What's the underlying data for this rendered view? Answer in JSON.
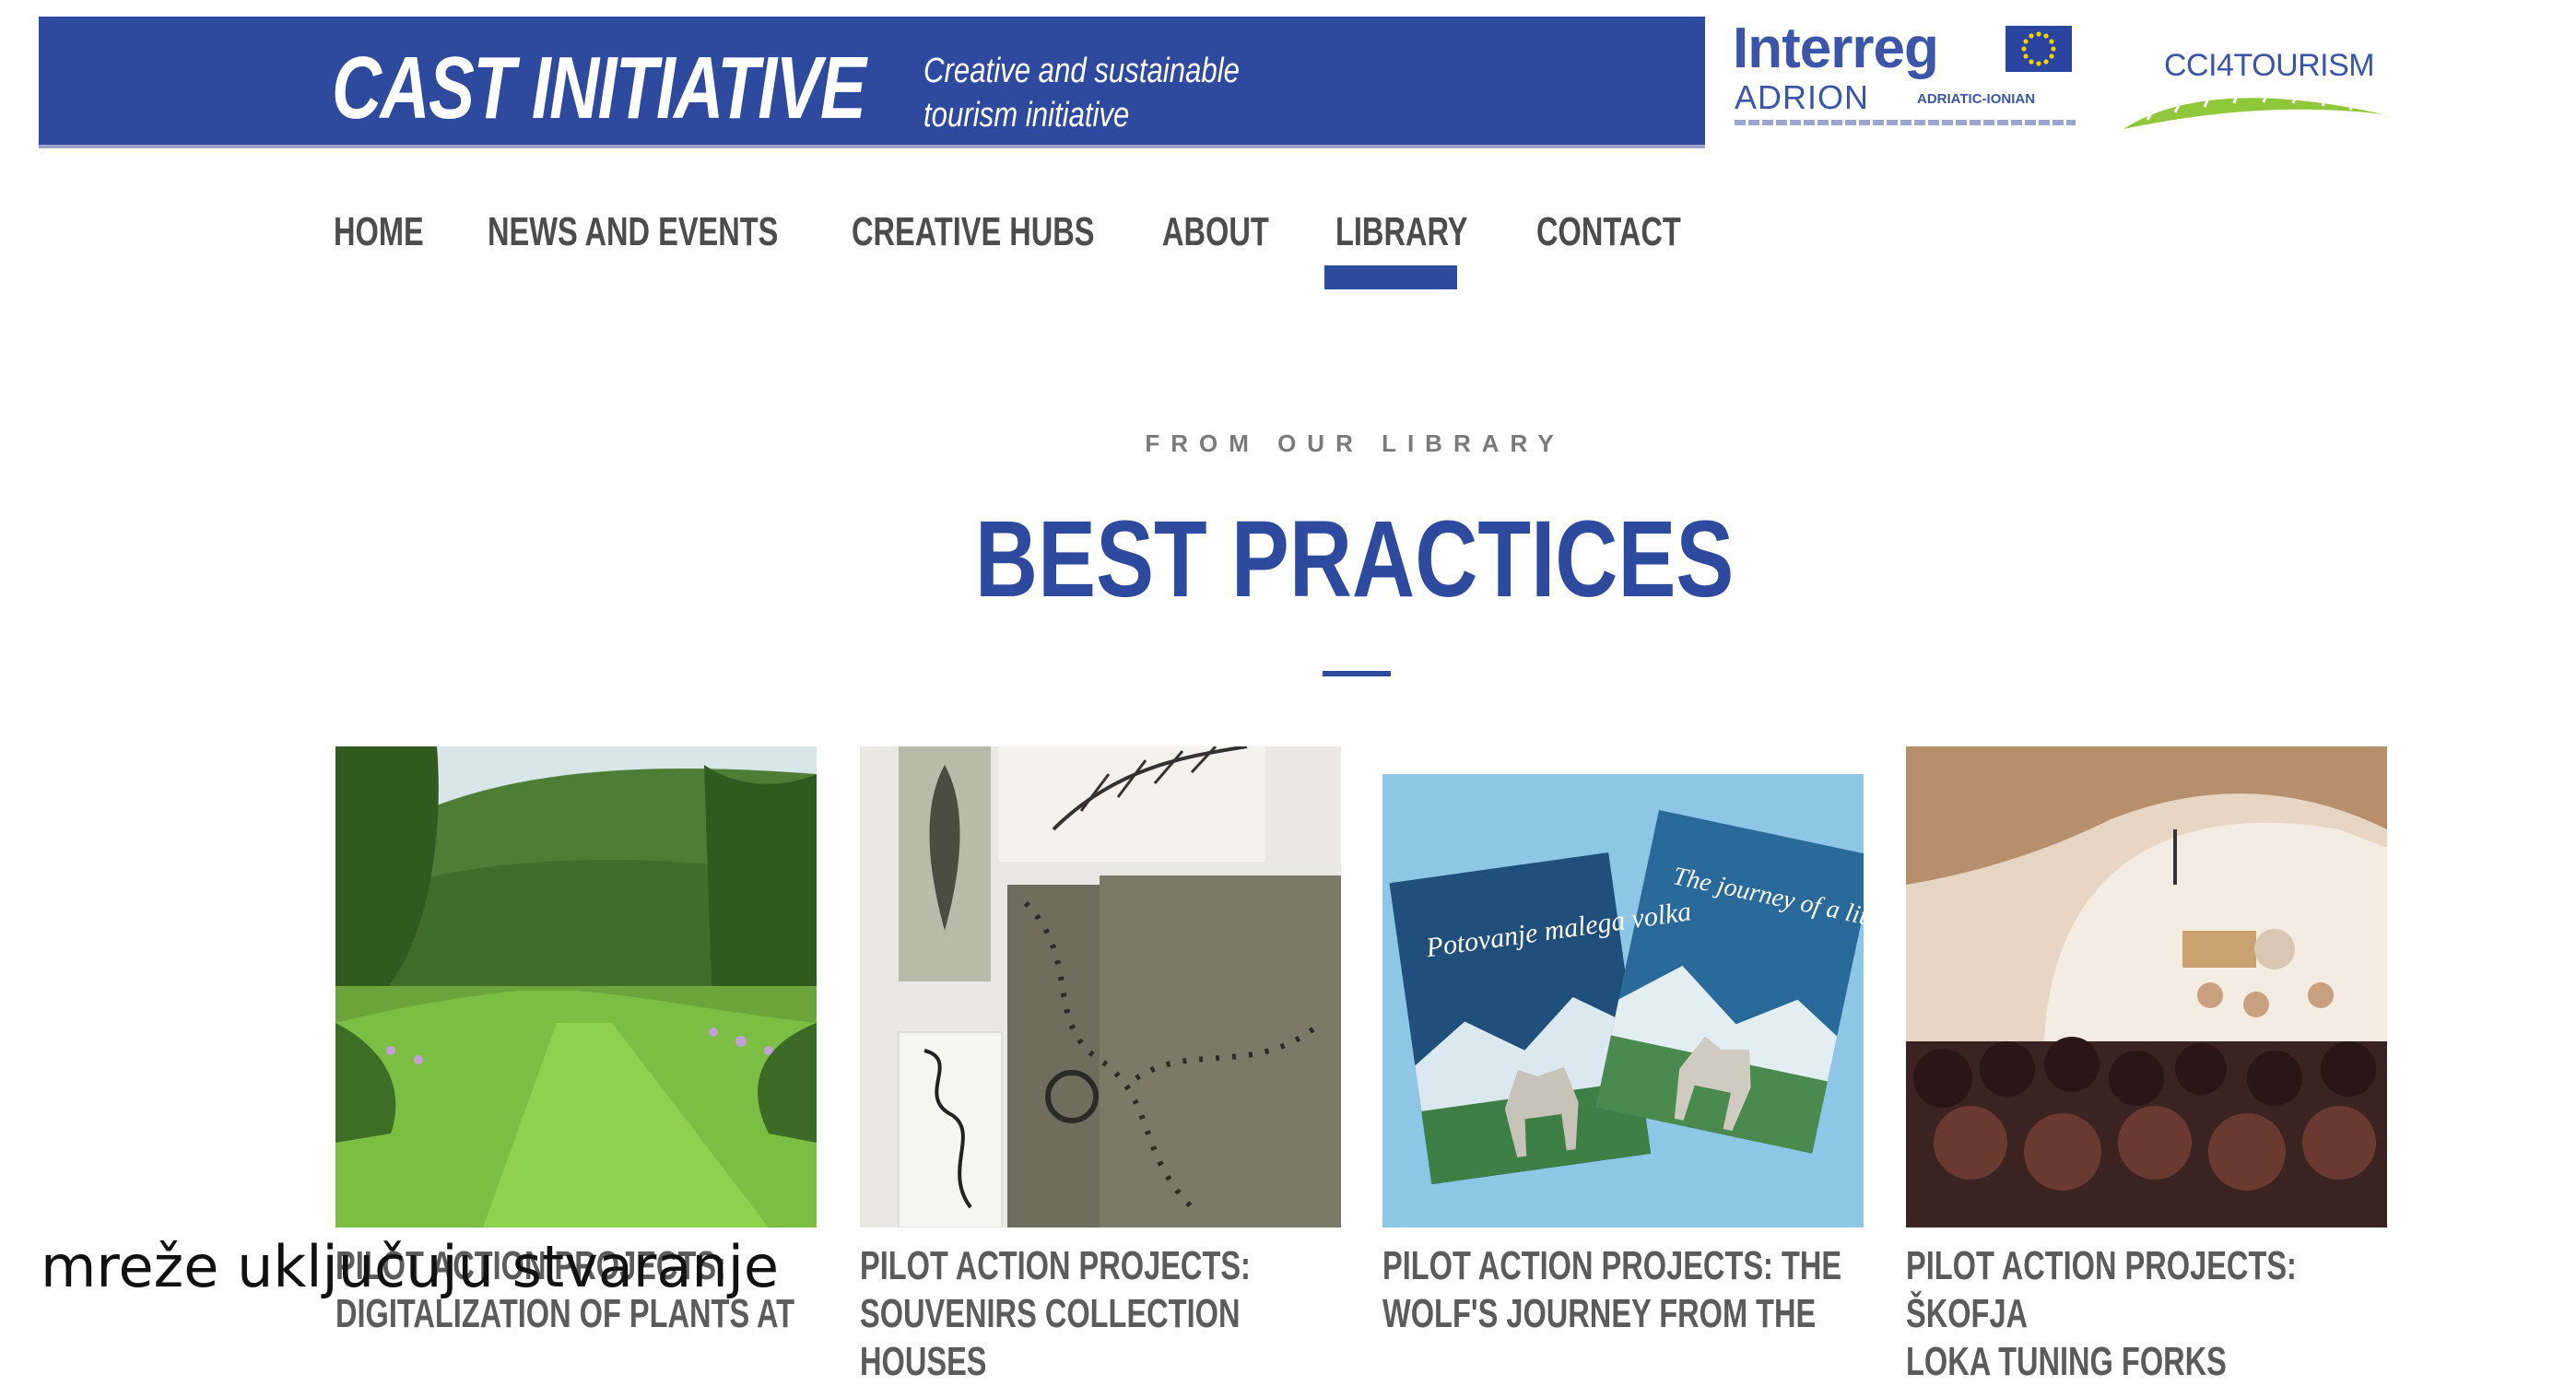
{
  "header": {
    "brand": "CAST INITIATIVE",
    "tagline_line1": "Creative and sustainable",
    "tagline_line2": "tourism initiative",
    "partner_logo_1": {
      "name": "Interreg",
      "subtitle": "ADRION",
      "sub2": "ADRIATIC-IONIAN"
    },
    "partner_logo_2": {
      "name": "CCI4TOURISM"
    }
  },
  "nav": {
    "items": [
      "HOME",
      "NEWS AND EVENTS",
      "CREATIVE HUBS",
      "ABOUT",
      "LIBRARY",
      "CONTACT"
    ],
    "active": "LIBRARY"
  },
  "section": {
    "eyebrow": "FROM OUR LIBRARY",
    "title": "BEST PRACTICES"
  },
  "cards": [
    {
      "caption_line1": "PILOT ACTION PROJECTS:",
      "caption_line2": "DIGITALIZATION OF PLANTS AT"
    },
    {
      "caption_line1": "PILOT ACTION PROJECTS:",
      "caption_line2": "SOUVENIRS COLLECTION HOUSES"
    },
    {
      "caption_line1": "PILOT ACTION PROJECTS: THE",
      "caption_line2": "WOLF'S JOURNEY FROM THE",
      "book_left_title": "Potovanje malega volka",
      "book_right_title": "The journey of a little wolf"
    },
    {
      "caption_line1": "PILOT ACTION PROJECTS: ŠKOFJA",
      "caption_line2": "LOKA TUNING FORKS"
    }
  ],
  "overlay_caption": "mreže uključuju stvaranje",
  "colors": {
    "brand_blue": "#2e4a9e",
    "nav_text": "#4c4c4c",
    "caption_text": "#5b5b5b"
  }
}
